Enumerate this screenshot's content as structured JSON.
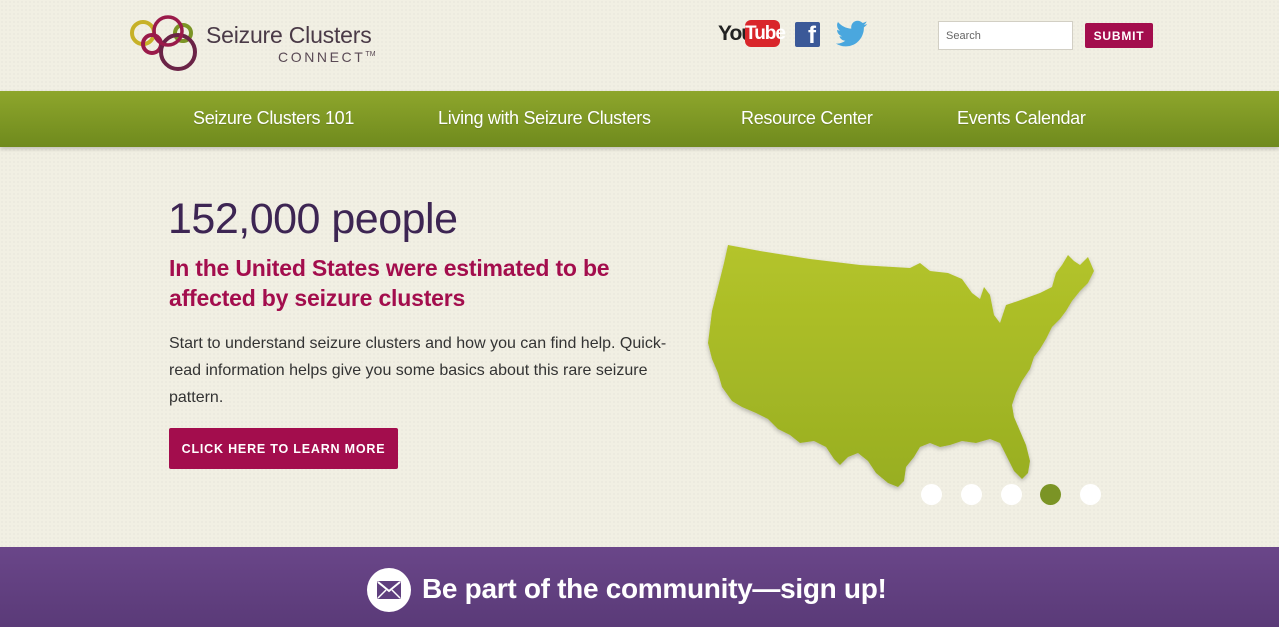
{
  "header": {
    "logo": {
      "title": "Seizure Clusters",
      "subtitle": "CONNECT",
      "trademark": "TM",
      "ring_colors": [
        "#c7b128",
        "#9a1a4a",
        "#7b9425",
        "#6a4689"
      ]
    },
    "social": {
      "youtube_icon": "youtube-icon",
      "youtube_you": "You",
      "youtube_tube": "Tube",
      "facebook_icon": "facebook-icon",
      "facebook_glyph": "f",
      "twitter_icon": "twitter-icon"
    },
    "search": {
      "placeholder": "Search",
      "value": "",
      "submit_label": "SUBMIT"
    }
  },
  "nav": {
    "items": [
      {
        "label": "Seizure Clusters 101"
      },
      {
        "label": "Living with Seizure Clusters"
      },
      {
        "label": "Resource Center"
      },
      {
        "label": "Events Calendar"
      }
    ]
  },
  "hero": {
    "stat": "152,000 people",
    "heading": "In the United States were estimated to be affected by seizure clusters",
    "body": "Start to understand seizure clusters and how you can find help. Quick-read information helps give you some basics about this rare seizure pattern.",
    "cta_label": "CLICK HERE TO LEARN MORE",
    "image_icon": "us-map",
    "carousel": {
      "slide_count": 5,
      "active_index": 3
    }
  },
  "signup": {
    "icon": "envelope-icon",
    "text": "Be part of the community—sign up!"
  },
  "colors": {
    "brand_magenta": "#a30d4d",
    "brand_purple": "#3d2553",
    "nav_green": "#7b9425",
    "map_green": "#a8bb26",
    "signup_purple": "#5f3f7e",
    "background": "#f1efe3"
  }
}
